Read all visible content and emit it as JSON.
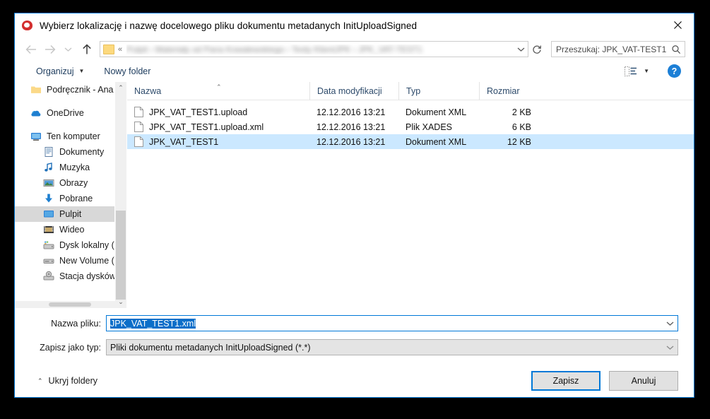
{
  "window": {
    "title": "Wybierz lokalizację i nazwę docelowego pliku dokumentu metadanych InitUploadSigned",
    "title_icon": "polish-eagle-icon",
    "close_label": "✕",
    "accent_color": "#0078d7",
    "selection_color": "#cbe8ff",
    "text_selection_color": "#0b6ec9"
  },
  "nav": {
    "back_label": "←",
    "forward_label": "→",
    "recent_label": "⌄",
    "up_label": "↑",
    "address_path_redacted": "Pulpit  ›  Materiały od Pana Kowalewskiego  ›  Testy KlientJPK  ›  JPK_VAT-TEST1",
    "address_chevrons": "«",
    "address_dropdown": "⌄",
    "refresh_label": "↻"
  },
  "search": {
    "placeholder": "Przeszukaj: JPK_VAT-TEST1",
    "icon": "search-icon"
  },
  "toolbar": {
    "organize_label": "Organizuj",
    "organize_caret": "▼",
    "new_folder_label": "Nowy folder",
    "view_caret": "▼",
    "help_label": "?"
  },
  "sidebar": {
    "items": [
      {
        "label": "Podręcznik - Ana",
        "icon": "folder-icon",
        "level": 1,
        "selected": false,
        "gap_before": false
      },
      {
        "label": "OneDrive",
        "icon": "onedrive-icon",
        "level": 0,
        "selected": false,
        "gap_before": true
      },
      {
        "label": "Ten komputer",
        "icon": "computer-icon",
        "level": 0,
        "selected": false,
        "gap_before": true
      },
      {
        "label": "Dokumenty",
        "icon": "documents-icon",
        "level": 2,
        "selected": false,
        "gap_before": false
      },
      {
        "label": "Muzyka",
        "icon": "music-icon",
        "level": 2,
        "selected": false,
        "gap_before": false
      },
      {
        "label": "Obrazy",
        "icon": "pictures-icon",
        "level": 2,
        "selected": false,
        "gap_before": false
      },
      {
        "label": "Pobrane",
        "icon": "downloads-icon",
        "level": 2,
        "selected": false,
        "gap_before": false
      },
      {
        "label": "Pulpit",
        "icon": "desktop-icon",
        "level": 2,
        "selected": true,
        "gap_before": false
      },
      {
        "label": "Wideo",
        "icon": "video-icon",
        "level": 2,
        "selected": false,
        "gap_before": false
      },
      {
        "label": "Dysk lokalny (C:)",
        "icon": "local-disk-icon",
        "level": 2,
        "selected": false,
        "gap_before": false
      },
      {
        "label": "New Volume (D:",
        "icon": "drive-icon",
        "level": 2,
        "selected": false,
        "gap_before": false
      },
      {
        "label": "Stacja dysków D",
        "icon": "optical-drive-icon",
        "level": 2,
        "selected": false,
        "gap_before": false
      }
    ],
    "scroll_up": "⌃",
    "scroll_down": "⌄"
  },
  "filelist": {
    "columns": [
      {
        "key": "name",
        "label": "Nazwa",
        "sorted": true,
        "sort_mark": "⌃"
      },
      {
        "key": "date",
        "label": "Data modyfikacji",
        "sorted": false,
        "sort_mark": ""
      },
      {
        "key": "type",
        "label": "Typ",
        "sorted": false,
        "sort_mark": ""
      },
      {
        "key": "size",
        "label": "Rozmiar",
        "sorted": false,
        "sort_mark": ""
      }
    ],
    "rows": [
      {
        "name": "JPK_VAT_TEST1.upload",
        "date": "12.12.2016 13:21",
        "type": "Dokument XML",
        "size": "2 KB",
        "selected": false
      },
      {
        "name": "JPK_VAT_TEST1.upload.xml",
        "date": "12.12.2016 13:21",
        "type": "Plik XADES",
        "size": "6 KB",
        "selected": false
      },
      {
        "name": "JPK_VAT_TEST1",
        "date": "12.12.2016 13:21",
        "type": "Dokument XML",
        "size": "12 KB",
        "selected": true
      }
    ]
  },
  "form": {
    "filename_label": "Nazwa pliku:",
    "filename_value": "JPK_VAT_TEST1.xml",
    "filetype_label": "Zapisz jako typ:",
    "filetype_value": "Pliki dokumentu metadanych InitUploadSigned (*.*)",
    "dropdown_glyph": "⌄"
  },
  "footer": {
    "hide_folders_label": "Ukryj foldery",
    "hide_folders_chev": "⌃",
    "save_label": "Zapisz",
    "cancel_label": "Anuluj"
  }
}
